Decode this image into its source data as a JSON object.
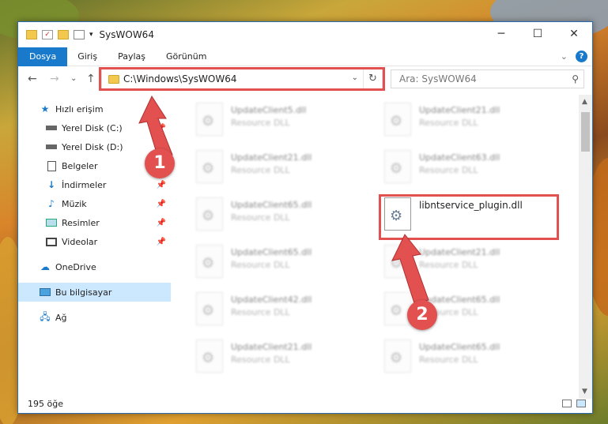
{
  "window": {
    "title": "SysWOW64",
    "controls": {
      "minimize": "─",
      "maximize": "☐",
      "close": "✕"
    }
  },
  "ribbon": {
    "tabs": [
      "Dosya",
      "Giriş",
      "Paylaş",
      "Görünüm"
    ],
    "collapse": "⌄",
    "help": "?"
  },
  "nav": {
    "back": "←",
    "forward": "→",
    "recent": "⌄",
    "up": "↑",
    "address": "C:\\Windows\\SysWOW64",
    "dropdown": "⌄",
    "refresh": "↻",
    "search_placeholder": "Ara: SysWOW64"
  },
  "sidebar": {
    "items": [
      {
        "label": "Hızlı erişim",
        "icon": "star-icon"
      },
      {
        "label": "Yerel Disk (C:)",
        "icon": "drive-icon"
      },
      {
        "label": "Yerel Disk (D:)",
        "icon": "drive-icon"
      },
      {
        "label": "Belgeler",
        "icon": "documents-icon"
      },
      {
        "label": "İndirmeler",
        "icon": "download-icon"
      },
      {
        "label": "Müzik",
        "icon": "music-icon"
      },
      {
        "label": "Resimler",
        "icon": "pictures-icon"
      },
      {
        "label": "Videolar",
        "icon": "videos-icon"
      },
      {
        "label": "OneDrive",
        "icon": "cloud-icon"
      },
      {
        "label": "Bu bilgisayar",
        "icon": "computer-icon"
      },
      {
        "label": "Ağ",
        "icon": "network-icon"
      }
    ]
  },
  "files": [
    {
      "name": "UpdateClient5.dll",
      "desc": "Resource DLL"
    },
    {
      "name": "UpdateClient21.dll",
      "desc": "Resource DLL"
    },
    {
      "name": "UpdateClient21.dll",
      "desc": "Resource DLL"
    },
    {
      "name": "UpdateClient63.dll",
      "desc": "Resource DLL"
    },
    {
      "name": "UpdateClient65.dll",
      "desc": "Resource DLL"
    },
    {
      "name": "libntservice_plugin.dll",
      "desc": ""
    },
    {
      "name": "UpdateClient65.dll",
      "desc": "Resource DLL"
    },
    {
      "name": "UpdateClient21.dll",
      "desc": "Resource DLL"
    },
    {
      "name": "UpdateClient42.dll",
      "desc": "Resource DLL"
    },
    {
      "name": "UpdateClient65.dll",
      "desc": "Resource DLL"
    },
    {
      "name": "UpdateClient21.dll",
      "desc": "Resource DLL"
    },
    {
      "name": "UpdateClient65.dll",
      "desc": "Resource DLL"
    }
  ],
  "status": {
    "count": "195 öğe"
  },
  "annotations": {
    "one": "1",
    "two": "2"
  },
  "colors": {
    "accent": "#1979ca",
    "highlight": "#e25050",
    "selected": "#cce8ff"
  }
}
